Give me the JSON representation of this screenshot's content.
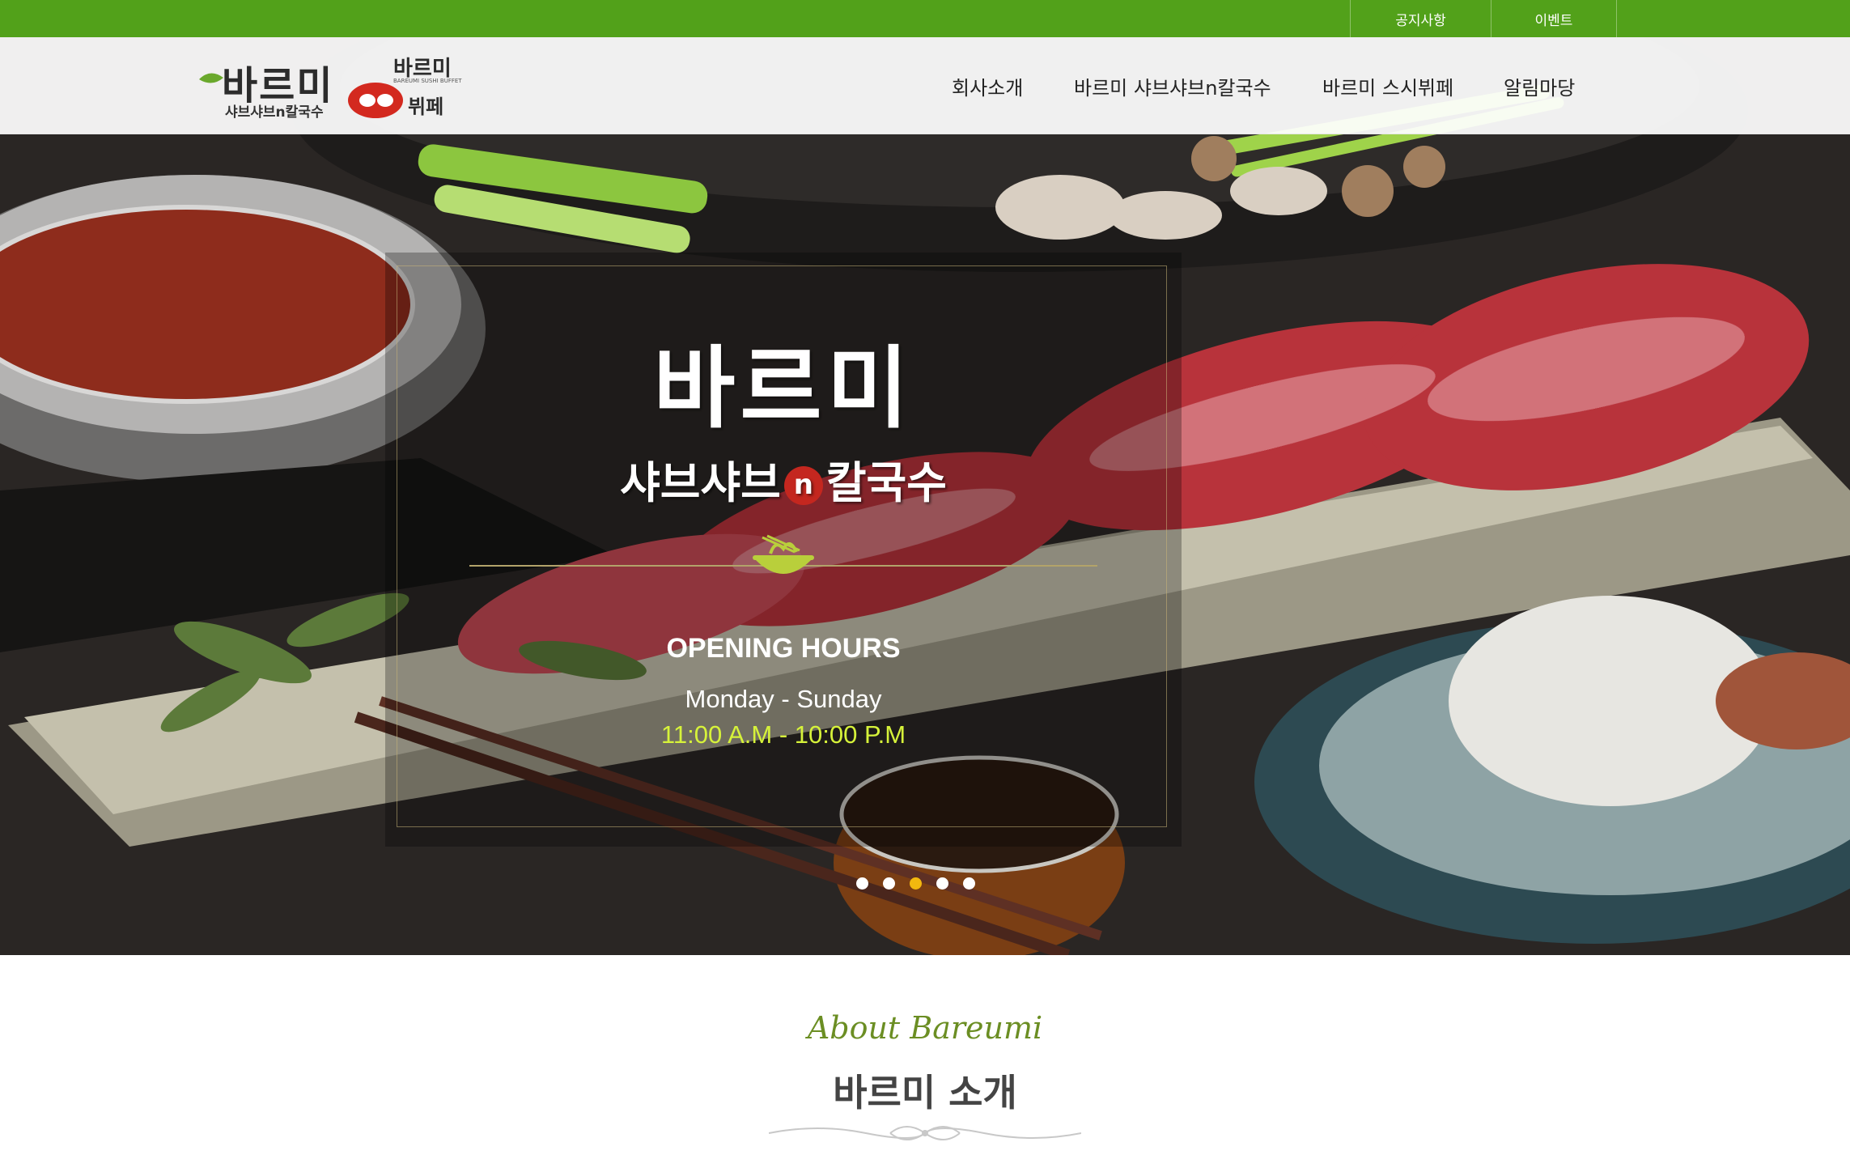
{
  "topbar": {
    "links": [
      {
        "label": "공지사항"
      },
      {
        "label": "이벤트"
      }
    ],
    "color": "#52a11a"
  },
  "header": {
    "logo_main": {
      "hangul": "바르미",
      "subtitle": "샤브샤브n칼국수"
    },
    "logo_secondary": {
      "hangul": "바르미",
      "small": "BAREUMI SUSHI BUFFET",
      "buffet": "뷔페"
    },
    "nav": [
      {
        "label": "회사소개"
      },
      {
        "label": "바르미 샤브샤브n칼국수"
      },
      {
        "label": "바르미 스시뷔페"
      },
      {
        "label": "알림마당"
      }
    ]
  },
  "hero": {
    "brand": "바르미",
    "brand_sub_left": "샤브샤브",
    "brand_sub_n": "n",
    "brand_sub_right": "칼국수",
    "hours_title": "OPENING HOURS",
    "hours_days": "Monday - Sunday",
    "hours_time": "11:00 A.M - 10:00 P.M",
    "slider": {
      "count": 5,
      "active_index": 2
    },
    "accent_time_color": "#d6f23a",
    "active_dot_color": "#f2b80f"
  },
  "about": {
    "script": "About Bareumi",
    "title": "바르미 소개"
  }
}
